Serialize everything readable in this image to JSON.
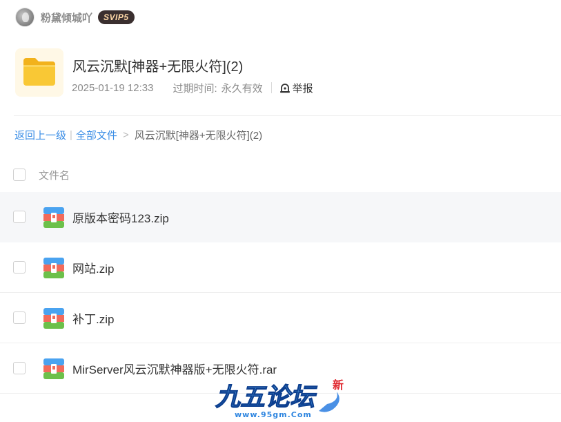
{
  "user": {
    "name": "粉黛倾城吖",
    "vip_badge": "SVIP5"
  },
  "folder": {
    "title": "风云沉默[神器+无限火符](2)",
    "created": "2025-01-19 12:33",
    "expire_label": "过期时间:",
    "expire_value": "永久有效",
    "report_label": "举报"
  },
  "breadcrumb": {
    "back": "返回上一级",
    "separator": "|",
    "all_files": "全部文件",
    "arrow": ">",
    "current": "风云沉默[神器+无限火符](2)"
  },
  "list": {
    "header": "文件名",
    "files": [
      {
        "name": "原版本密码123.zip"
      },
      {
        "name": "网站.zip"
      },
      {
        "name": "补丁.zip"
      },
      {
        "name": "MirServer风云沉默神器版+无限火符.rar"
      }
    ]
  },
  "watermark": {
    "title": "九五论坛",
    "url": "www.95gm.Com",
    "badge": "新"
  },
  "icons": {
    "folder": "folder-icon",
    "file": "zip-archive-icon",
    "report": "report-icon"
  },
  "colors": {
    "link": "#3b8ee6",
    "vip_badge_bg": "#3a2f2f",
    "vip_badge_text": "#ffd9a8",
    "folder_icon": "#f7c233",
    "row_hover": "#f6f7f9"
  }
}
